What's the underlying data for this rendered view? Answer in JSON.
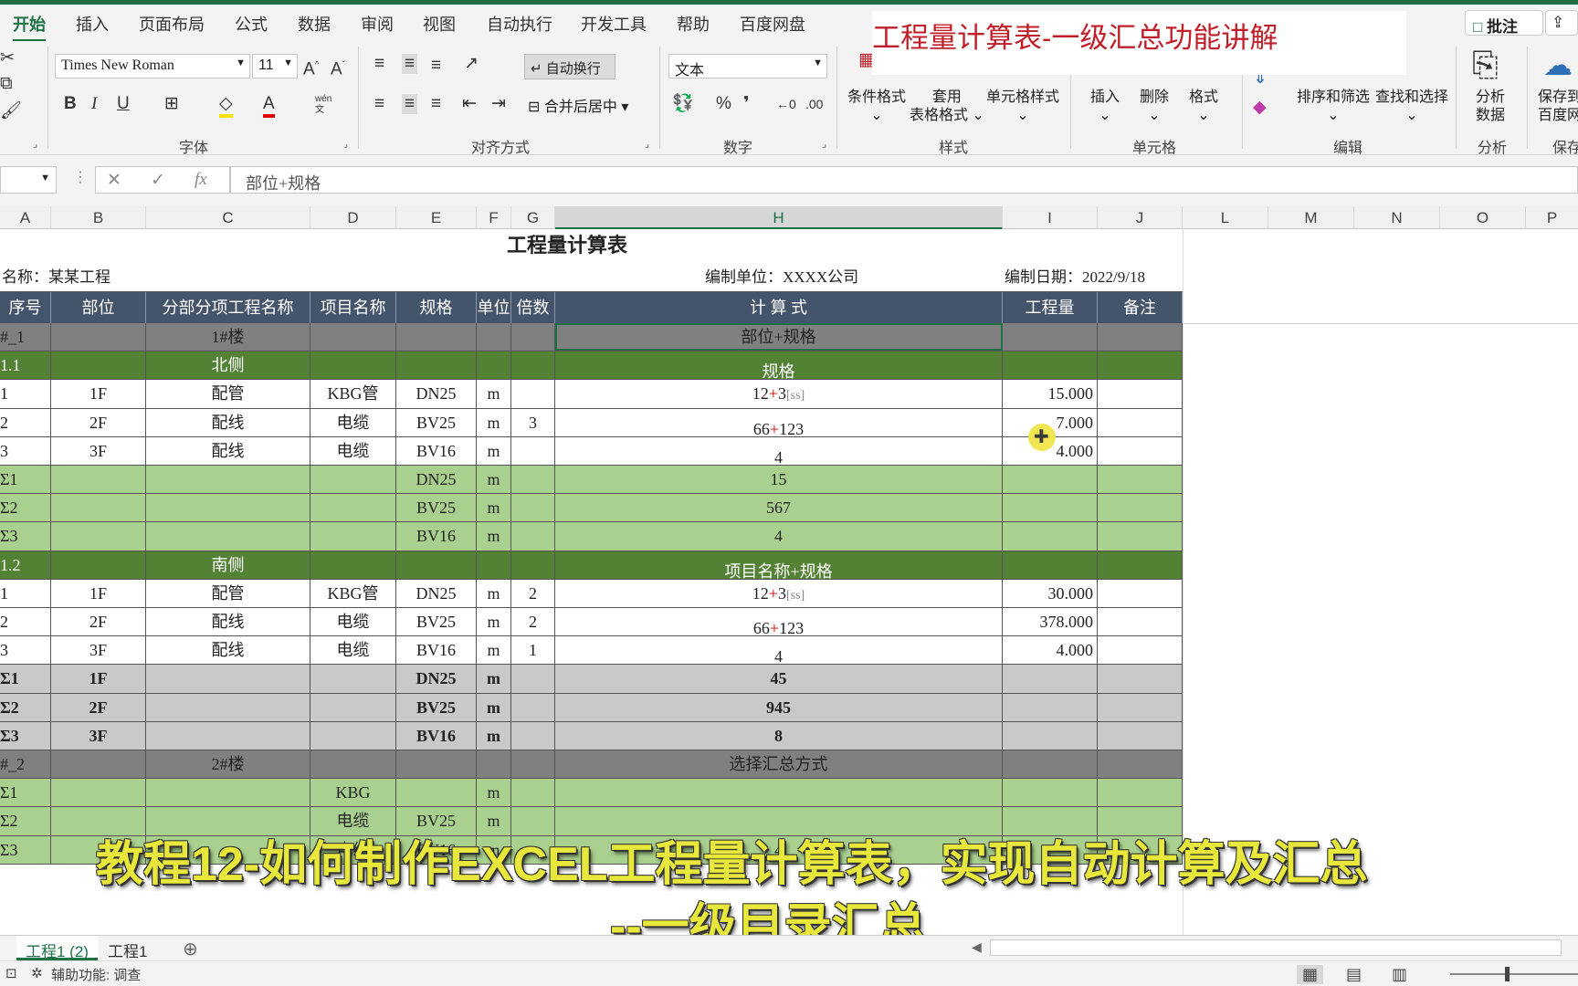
{
  "ribbon": {
    "tabs": [
      "开始",
      "插入",
      "页面布局",
      "公式",
      "数据",
      "审阅",
      "视图",
      "自动执行",
      "开发工具",
      "帮助",
      "百度网盘"
    ],
    "comment_button": "批注",
    "font_name": "Times New Roman",
    "font_size": "11",
    "font_group": "字体",
    "wrap_text": "自动换行",
    "merge_center": "合并后居中",
    "align_group": "对齐方式",
    "number_format": "文本",
    "number_group": "数字",
    "conditional_format": "条件格式",
    "table_format_1": "套用",
    "table_format_2": "表格格式",
    "cell_style": "单元格样式",
    "style_group": "样式",
    "insert": "插入",
    "delete": "删除",
    "format": "格式",
    "cells_group": "单元格",
    "sort_filter": "排序和筛选",
    "find_select": "查找和选择",
    "edit_group": "编辑",
    "analyze_1": "分析",
    "analyze_2": "数据",
    "analyze_group": "分析",
    "save_1": "保存到",
    "save_2": "百度网",
    "save_group": "保存",
    "wen_label": "wén"
  },
  "video_title": "工程量计算表-一级汇总功能讲解",
  "formula_bar": {
    "content": "部位+规格",
    "fx": "fx"
  },
  "columns": [
    "A",
    "B",
    "C",
    "D",
    "E",
    "F",
    "G",
    "H",
    "I",
    "J",
    "L",
    "M",
    "N",
    "O",
    "P"
  ],
  "sheet": {
    "title": "工程量计算表",
    "project_name": "名称：某某工程",
    "unit": "编制单位：XXXX公司",
    "date": "编制日期：2022/9/18",
    "headers": [
      "序号",
      "部位",
      "分部分项工程名称",
      "项目名称",
      "规格",
      "单位",
      "倍数",
      "计 算 式",
      "工程量",
      "备注"
    ],
    "rows": [
      {
        "type": "grp1",
        "a": "#_1",
        "c": "1#楼",
        "h": "部位+规格"
      },
      {
        "type": "grp2",
        "a": "1.1",
        "c": "北侧",
        "h": "规格"
      },
      {
        "type": "white",
        "a": "1",
        "b": "1F",
        "c": "配管",
        "d": "KBG管",
        "e": "DN25",
        "f": "m",
        "g": "",
        "h1": "12",
        "h2": "+",
        "h3": "3",
        "hs": "[ss]",
        "i": "15.000"
      },
      {
        "type": "white",
        "a": "2",
        "b": "2F",
        "c": "配线",
        "d": "电缆",
        "e": "BV25",
        "f": "m",
        "g": "3",
        "h1": "66",
        "h2": "+",
        "h3": "123",
        "hs": "",
        "i": "7.000"
      },
      {
        "type": "white",
        "a": "3",
        "b": "3F",
        "c": "配线",
        "d": "电缆",
        "e": "BV16",
        "f": "m",
        "g": "",
        "h1": "4",
        "h2": "",
        "h3": "",
        "hs": "",
        "i": "4.000"
      },
      {
        "type": "sum",
        "a": "Σ1",
        "e": "DN25",
        "f": "m",
        "h": "15"
      },
      {
        "type": "sum",
        "a": "Σ2",
        "e": "BV25",
        "f": "m",
        "h": "567"
      },
      {
        "type": "sum",
        "a": "Σ3",
        "e": "BV16",
        "f": "m",
        "h": "4"
      },
      {
        "type": "grp2",
        "a": "1.2",
        "c": "南侧",
        "h": "项目名称+规格"
      },
      {
        "type": "white",
        "a": "1",
        "b": "1F",
        "c": "配管",
        "d": "KBG管",
        "e": "DN25",
        "f": "m",
        "g": "2",
        "h1": "12",
        "h2": "+",
        "h3": "3",
        "hs": "[ss]",
        "i": "30.000"
      },
      {
        "type": "white",
        "a": "2",
        "b": "2F",
        "c": "配线",
        "d": "电缆",
        "e": "BV25",
        "f": "m",
        "g": "2",
        "h1": "66",
        "h2": "+",
        "h3": "123",
        "hs": "",
        "i": "378.000"
      },
      {
        "type": "white",
        "a": "3",
        "b": "3F",
        "c": "配线",
        "d": "电缆",
        "e": "BV16",
        "f": "m",
        "g": "1",
        "h1": "4",
        "h2": "",
        "h3": "",
        "hs": "",
        "i": "4.000"
      },
      {
        "type": "sumg",
        "a": "Σ1",
        "b": "1F",
        "e": "DN25",
        "f": "m",
        "h": "45"
      },
      {
        "type": "sumg",
        "a": "Σ2",
        "b": "2F",
        "e": "BV25",
        "f": "m",
        "h": "945"
      },
      {
        "type": "sumg",
        "a": "Σ3",
        "b": "3F",
        "e": "BV16",
        "f": "m",
        "h": "8"
      },
      {
        "type": "grp1",
        "a": "#_2",
        "c": "2#楼",
        "h": "选择汇总方式"
      },
      {
        "type": "sum",
        "a": "Σ1",
        "d": "KBG",
        "f": "m"
      },
      {
        "type": "sum",
        "a": "Σ2",
        "d": "电缆",
        "e": "BV25",
        "f": "m"
      },
      {
        "type": "sum",
        "a": "Σ3",
        "d": "电缆",
        "e": "BV16",
        "f": "m",
        "h": "4"
      }
    ]
  },
  "sheet_tabs": [
    "工程1 (2)",
    "工程1"
  ],
  "status": {
    "accessibility": "辅助功能: 调查"
  },
  "subtitle": {
    "line1": "教程12-如何制作EXCEL工程量计算表，实现自动计算及汇总",
    "line2": "--一级目录汇总"
  }
}
